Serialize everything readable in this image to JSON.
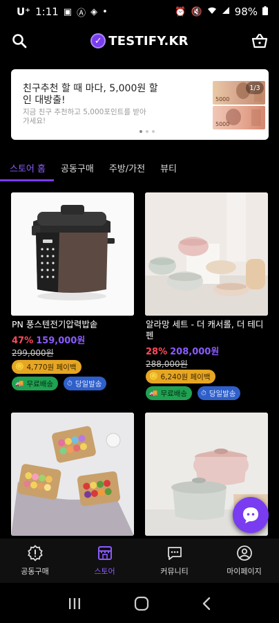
{
  "status_bar": {
    "carrier": "U⁺",
    "time": "1:11",
    "battery": "98%"
  },
  "header": {
    "logo_text": "TESTIFY.KR",
    "search_icon": "search-icon",
    "cart_icon": "basket-icon"
  },
  "banner": {
    "title": "친구추천 할 때 마다, 5,000원 할인 대방출!",
    "subtitle": "지금 친구 추천하고 5,000포인트를 받아가세요!",
    "bill_1": "5000",
    "bill_2": "5000",
    "pager": "1/3"
  },
  "tabs": [
    {
      "label": "스토어 홈"
    },
    {
      "label": "공동구매"
    },
    {
      "label": "주방/가전"
    },
    {
      "label": "뷰티"
    }
  ],
  "products": [
    {
      "title": "PN 풍스텐전기압력밥솥",
      "discount": "47%",
      "price": "159,000원",
      "original_price": "299,000원",
      "payback": "4,770원 페이백",
      "free_shipping": "무료배송",
      "same_day": "당일발송"
    },
    {
      "title": "알라망 세트 - 더 캐서롤, 더 테디펜",
      "discount": "28%",
      "price": "208,000원",
      "original_price": "288,000원",
      "payback": "6,240원 페이백",
      "free_shipping": "무료배송",
      "same_day": "당일발송"
    }
  ],
  "bottom_nav": [
    {
      "label": "공동구매",
      "icon": "badge-alert-icon"
    },
    {
      "label": "스토어",
      "icon": "store-icon"
    },
    {
      "label": "커뮤니티",
      "icon": "chat-icon"
    },
    {
      "label": "마이페이지",
      "icon": "user-circle-icon"
    }
  ],
  "colors": {
    "accent": "#7a3cf0",
    "discount": "#ff4a5b",
    "payback_chip": "#e6a623",
    "free_shipping_chip": "#1fa252",
    "same_day_chip": "#2f5fc9"
  }
}
